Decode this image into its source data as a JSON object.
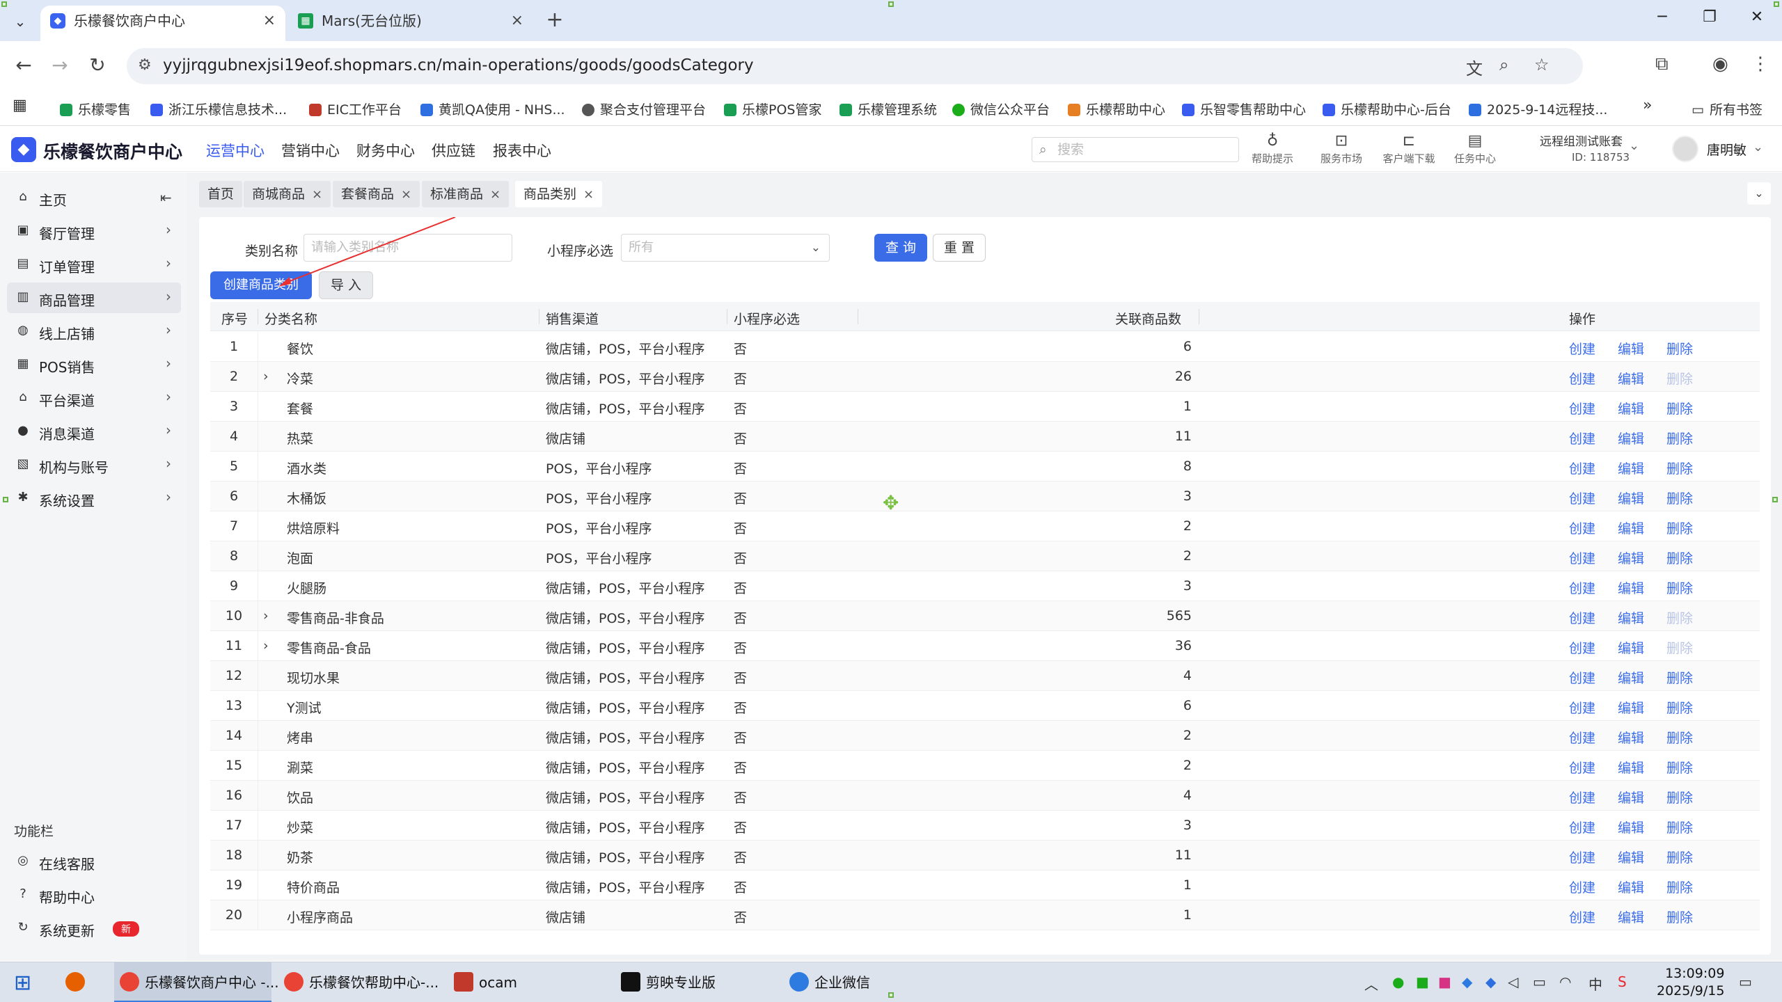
{
  "browser": {
    "tabs": [
      {
        "title": "乐檬餐饮商户中心",
        "icon": "lemon-logo-icon"
      },
      {
        "title": "Mars(无台位版)",
        "icon": "sheets-icon"
      }
    ],
    "url": "yyjjrqgubnexjsi19eof.shopmars.cn/main-operations/goods/goodsCategory",
    "bookmarks": [
      {
        "label": "乐檬零售",
        "color": "#1a9e53"
      },
      {
        "label": "浙江乐檬信息技术...",
        "color": "#3a5bf0"
      },
      {
        "label": "EIC工作平台",
        "color": "#c0392b"
      },
      {
        "label": "黄凯QA使用 - NHS...",
        "color": "#2d6fe0"
      },
      {
        "label": "聚合支付管理平台",
        "color": "#555555"
      },
      {
        "label": "乐檬POS管家",
        "color": "#1a9e53"
      },
      {
        "label": "乐檬管理系统",
        "color": "#1a9e53"
      },
      {
        "label": "微信公众平台",
        "color": "#1aad19"
      },
      {
        "label": "乐檬帮助中心",
        "color": "#e67e22"
      },
      {
        "label": "乐智零售帮助中心",
        "color": "#3a5bf0"
      },
      {
        "label": "乐檬帮助中心-后台",
        "color": "#3a5bf0"
      },
      {
        "label": "2025-9-14远程技...",
        "color": "#2d6fe0"
      }
    ],
    "all_bookmarks": "所有书签"
  },
  "header": {
    "logo": "乐檬餐饮商户中心",
    "nav": [
      "运营中心",
      "营销中心",
      "财务中心",
      "供应链",
      "报表中心"
    ],
    "search_placeholder": "搜索",
    "tools": [
      "帮助提示",
      "服务市场",
      "客户端下载",
      "任务中心"
    ],
    "store_name": "远程组测试账套",
    "store_id": "ID: 118753",
    "user": "唐明敏"
  },
  "sidebar": {
    "items": [
      {
        "label": "主页",
        "icon": "home-icon"
      },
      {
        "label": "餐厅管理",
        "icon": "store-icon"
      },
      {
        "label": "订单管理",
        "icon": "order-icon"
      },
      {
        "label": "商品管理",
        "icon": "goods-icon"
      },
      {
        "label": "线上店铺",
        "icon": "globe-icon"
      },
      {
        "label": "POS销售",
        "icon": "pos-icon"
      },
      {
        "label": "平台渠道",
        "icon": "bank-icon"
      },
      {
        "label": "消息渠道",
        "icon": "message-icon"
      },
      {
        "label": "机构与账号",
        "icon": "account-icon"
      },
      {
        "label": "系统设置",
        "icon": "gear-icon"
      }
    ],
    "func_title": "功能栏",
    "func_items": [
      {
        "label": "在线客服",
        "icon": "headset-icon"
      },
      {
        "label": "帮助中心",
        "icon": "help-icon"
      },
      {
        "label": "系统更新",
        "icon": "refresh-icon",
        "badge": "新"
      }
    ]
  },
  "page_tabs": [
    "首页",
    "商城商品",
    "套餐商品",
    "标准商品",
    "商品类别"
  ],
  "filters": {
    "name_label": "类别名称",
    "name_placeholder": "请输入类别名称",
    "required_label": "小程序必选",
    "required_value": "所有",
    "query": "查 询",
    "reset": "重 置",
    "create": "创建商品类别",
    "import": "导 入"
  },
  "table": {
    "headers": [
      "序号",
      "分类名称",
      "销售渠道",
      "小程序必选",
      "关联商品数",
      "操作"
    ],
    "actions": [
      "创建",
      "编辑",
      "删除"
    ],
    "rows": [
      {
        "idx": "1",
        "name": "餐饮",
        "channel": "微店铺，POS，平台小程序",
        "required": "否",
        "count": "6",
        "expand": false,
        "del_disabled": false
      },
      {
        "idx": "2",
        "name": "冷菜",
        "channel": "微店铺，POS，平台小程序",
        "required": "否",
        "count": "26",
        "expand": true,
        "del_disabled": true
      },
      {
        "idx": "3",
        "name": "套餐",
        "channel": "微店铺，POS，平台小程序",
        "required": "否",
        "count": "1",
        "expand": false,
        "del_disabled": false
      },
      {
        "idx": "4",
        "name": "热菜",
        "channel": "微店铺",
        "required": "否",
        "count": "11",
        "expand": false,
        "del_disabled": false
      },
      {
        "idx": "5",
        "name": "酒水类",
        "channel": "POS，平台小程序",
        "required": "否",
        "count": "8",
        "expand": false,
        "del_disabled": false
      },
      {
        "idx": "6",
        "name": "木桶饭",
        "channel": "POS，平台小程序",
        "required": "否",
        "count": "3",
        "expand": false,
        "del_disabled": false
      },
      {
        "idx": "7",
        "name": "烘焙原料",
        "channel": "POS，平台小程序",
        "required": "否",
        "count": "2",
        "expand": false,
        "del_disabled": false
      },
      {
        "idx": "8",
        "name": "泡面",
        "channel": "POS，平台小程序",
        "required": "否",
        "count": "2",
        "expand": false,
        "del_disabled": false
      },
      {
        "idx": "9",
        "name": "火腿肠",
        "channel": "微店铺，POS，平台小程序",
        "required": "否",
        "count": "3",
        "expand": false,
        "del_disabled": false
      },
      {
        "idx": "10",
        "name": "零售商品-非食品",
        "channel": "微店铺，POS，平台小程序",
        "required": "否",
        "count": "565",
        "expand": true,
        "del_disabled": true
      },
      {
        "idx": "11",
        "name": "零售商品-食品",
        "channel": "微店铺，POS，平台小程序",
        "required": "否",
        "count": "36",
        "expand": true,
        "del_disabled": true
      },
      {
        "idx": "12",
        "name": "现切水果",
        "channel": "微店铺，POS，平台小程序",
        "required": "否",
        "count": "4",
        "expand": false,
        "del_disabled": false
      },
      {
        "idx": "13",
        "name": "Y测试",
        "channel": "微店铺，POS，平台小程序",
        "required": "否",
        "count": "6",
        "expand": false,
        "del_disabled": false
      },
      {
        "idx": "14",
        "name": "烤串",
        "channel": "微店铺，POS，平台小程序",
        "required": "否",
        "count": "2",
        "expand": false,
        "del_disabled": false
      },
      {
        "idx": "15",
        "name": "涮菜",
        "channel": "微店铺，POS，平台小程序",
        "required": "否",
        "count": "2",
        "expand": false,
        "del_disabled": false
      },
      {
        "idx": "16",
        "name": "饮品",
        "channel": "微店铺，POS，平台小程序",
        "required": "否",
        "count": "4",
        "expand": false,
        "del_disabled": false
      },
      {
        "idx": "17",
        "name": "炒菜",
        "channel": "微店铺，POS，平台小程序",
        "required": "否",
        "count": "3",
        "expand": false,
        "del_disabled": false
      },
      {
        "idx": "18",
        "name": "奶茶",
        "channel": "微店铺，POS，平台小程序",
        "required": "否",
        "count": "11",
        "expand": false,
        "del_disabled": false
      },
      {
        "idx": "19",
        "name": "特价商品",
        "channel": "微店铺，POS，平台小程序",
        "required": "否",
        "count": "1",
        "expand": false,
        "del_disabled": false
      },
      {
        "idx": "20",
        "name": "小程序商品",
        "channel": "微店铺",
        "required": "否",
        "count": "1",
        "expand": false,
        "del_disabled": false
      }
    ]
  },
  "taskbar": {
    "items": [
      {
        "label": "乐檬餐饮商户中心 -...",
        "color": "#e94335"
      },
      {
        "label": "乐檬餐饮帮助中心-...",
        "color": "#e94335"
      },
      {
        "label": "ocam",
        "color": "#c0392b"
      },
      {
        "label": "剪映专业版",
        "color": "#111111"
      },
      {
        "label": "企业微信",
        "color": "#2d7be0"
      }
    ],
    "ime": "中",
    "time": "13:09:09",
    "date": "2025/9/15"
  }
}
